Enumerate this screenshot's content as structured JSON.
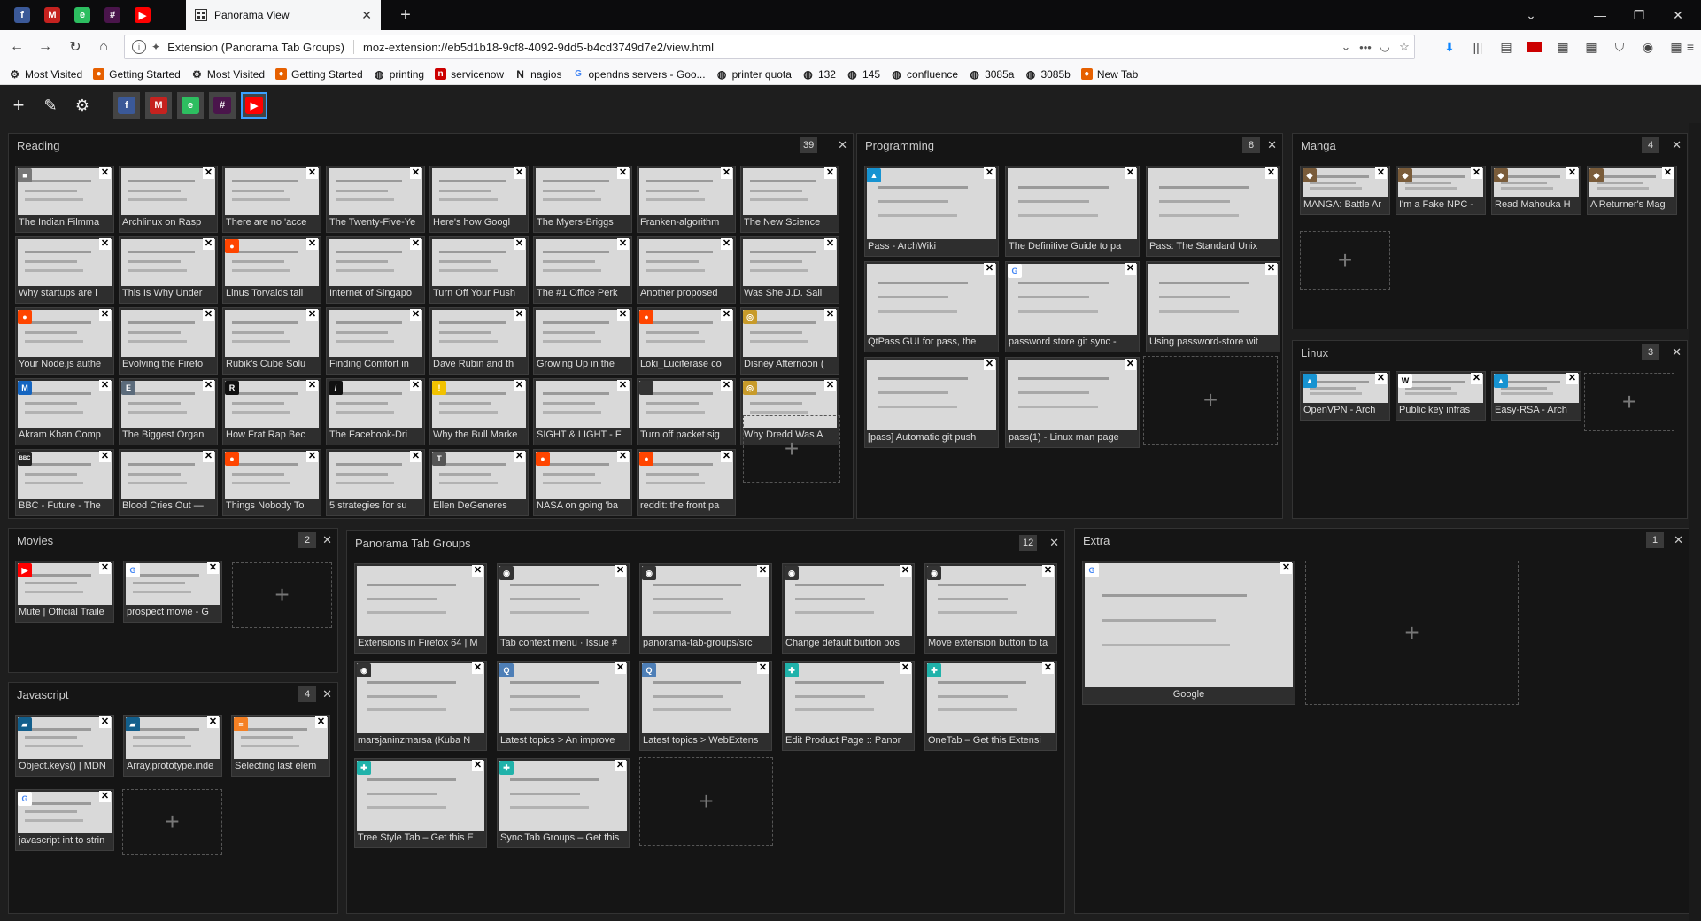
{
  "browser": {
    "pinned_tabs": [
      {
        "icon": "facebook-icon",
        "glyph": "f",
        "color": "#3b5998"
      },
      {
        "icon": "gmail-icon",
        "glyph": "M",
        "color": "#c5221f"
      },
      {
        "icon": "evernote-icon",
        "glyph": "e",
        "color": "#2dbe60"
      },
      {
        "icon": "slack-icon",
        "glyph": "#",
        "color": "#4a154b"
      },
      {
        "icon": "youtube-icon",
        "glyph": "▶",
        "color": "#ff0000"
      }
    ],
    "active_tab_title": "Panorama View",
    "url_identity": "Extension (Panorama Tab Groups)",
    "url": "moz-extension://eb5d1b18-9cf8-4092-9dd5-b4cd3749d7e2/view.html"
  },
  "bookmarks": [
    {
      "label": "Most Visited",
      "icon": "gear-icon"
    },
    {
      "label": "Getting Started",
      "icon": "firefox-icon"
    },
    {
      "label": "Most Visited",
      "icon": "gear-icon"
    },
    {
      "label": "Getting Started",
      "icon": "firefox-icon"
    },
    {
      "label": "printing",
      "icon": "globe-icon"
    },
    {
      "label": "servicenow",
      "icon": "servicenow-icon"
    },
    {
      "label": "nagios",
      "icon": "nagios-icon"
    },
    {
      "label": "opendns servers - Goo...",
      "icon": "google-icon"
    },
    {
      "label": "printer quota",
      "icon": "globe-icon"
    },
    {
      "label": "132",
      "icon": "globe-icon"
    },
    {
      "label": "145",
      "icon": "globe-icon"
    },
    {
      "label": "confluence",
      "icon": "globe-icon"
    },
    {
      "label": "3085a",
      "icon": "globe-icon"
    },
    {
      "label": "3085b",
      "icon": "globe-icon"
    },
    {
      "label": "New Tab",
      "icon": "firefox-icon"
    }
  ],
  "new_tab_glyph": "+",
  "groups": [
    {
      "name": "Reading",
      "count": "39",
      "tabs": [
        {
          "title": "The Indian Filmma",
          "icon": "doc-icon"
        },
        {
          "title": "Archlinux on Rasp",
          "icon": ""
        },
        {
          "title": "There are no 'acce",
          "icon": ""
        },
        {
          "title": "The Twenty-Five-Ye",
          "icon": ""
        },
        {
          "title": "Here's how Googl",
          "icon": ""
        },
        {
          "title": "The Myers-Briggs",
          "icon": ""
        },
        {
          "title": "Franken-algorithm",
          "icon": ""
        },
        {
          "title": "The New Science",
          "icon": ""
        },
        {
          "title": "Why startups are l",
          "icon": ""
        },
        {
          "title": "This Is Why Under",
          "icon": ""
        },
        {
          "title": "Linus Torvalds tall",
          "icon": "reddit-icon"
        },
        {
          "title": "Internet of Singapo",
          "icon": ""
        },
        {
          "title": "Turn Off Your Push",
          "icon": ""
        },
        {
          "title": "The #1 Office Perk",
          "icon": ""
        },
        {
          "title": "Another proposed",
          "icon": ""
        },
        {
          "title": "Was She J.D. Sali",
          "icon": ""
        },
        {
          "title": "Your Node.js authe",
          "icon": "reddit-icon"
        },
        {
          "title": "Evolving the Firefo",
          "icon": ""
        },
        {
          "title": "Rubik's Cube Solu",
          "icon": ""
        },
        {
          "title": "Finding Comfort in",
          "icon": ""
        },
        {
          "title": "Dave Rubin and th",
          "icon": ""
        },
        {
          "title": "Growing Up in the",
          "icon": ""
        },
        {
          "title": "Loki_Luciferase co",
          "icon": "reddit-icon"
        },
        {
          "title": "Disney Afternoon (",
          "icon": "site-icon"
        },
        {
          "title": "Akram Khan Comp",
          "icon": "medium-icon"
        },
        {
          "title": "The Biggest Organ",
          "icon": "e-icon"
        },
        {
          "title": "How Frat Rap Bec",
          "icon": "r-icon"
        },
        {
          "title": "The Facebook-Dri",
          "icon": "a-icon"
        },
        {
          "title": "Why the Bull Marke",
          "icon": "warning-icon"
        },
        {
          "title": "SIGHT & LIGHT - F",
          "icon": ""
        },
        {
          "title": "Turn off packet sig",
          "icon": "apple-icon"
        },
        {
          "title": "Why Dredd Was A",
          "icon": "site-icon"
        },
        {
          "title": "BBC - Future - The",
          "icon": "bbc-icon"
        },
        {
          "title": "Blood Cries Out —",
          "icon": ""
        },
        {
          "title": "Things Nobody To",
          "icon": "reddit-icon"
        },
        {
          "title": "5 strategies for su",
          "icon": ""
        },
        {
          "title": "Ellen DeGeneres",
          "icon": "t-icon"
        },
        {
          "title": "NASA on going 'ba",
          "icon": "reddit-icon"
        },
        {
          "title": "reddit: the front pa",
          "icon": "reddit-icon"
        }
      ]
    },
    {
      "name": "Programming",
      "count": "8",
      "tabs": [
        {
          "title": "Pass - ArchWiki",
          "icon": "arch-icon"
        },
        {
          "title": "The Definitive Guide to pa",
          "icon": ""
        },
        {
          "title": "Pass: The Standard Unix",
          "icon": ""
        },
        {
          "title": "QtPass GUI for pass, the",
          "icon": ""
        },
        {
          "title": "password store git sync -",
          "icon": "google-icon"
        },
        {
          "title": "Using password-store wit",
          "icon": ""
        },
        {
          "title": "[pass] Automatic git push",
          "icon": ""
        },
        {
          "title": "pass(1) - Linux man page",
          "icon": ""
        }
      ]
    },
    {
      "name": "Manga",
      "count": "4",
      "tabs": [
        {
          "title": "MANGA: Battle Ar",
          "icon": "manga-icon"
        },
        {
          "title": "I'm a Fake NPC -",
          "icon": "manga-icon"
        },
        {
          "title": "Read Mahouka H",
          "icon": "manga-icon"
        },
        {
          "title": "A Returner's Mag",
          "icon": "manga-icon"
        }
      ]
    },
    {
      "name": "Linux",
      "count": "3",
      "tabs": [
        {
          "title": "OpenVPN - Arch",
          "icon": "arch-icon"
        },
        {
          "title": "Public key infras",
          "icon": "wikipedia-icon"
        },
        {
          "title": "Easy-RSA - Arch",
          "icon": "arch-icon"
        }
      ]
    },
    {
      "name": "Movies",
      "count": "2",
      "tabs": [
        {
          "title": "Mute | Official Traile",
          "icon": "youtube-icon"
        },
        {
          "title": "prospect movie - G",
          "icon": "google-icon"
        }
      ]
    },
    {
      "name": "Javascript",
      "count": "4",
      "tabs": [
        {
          "title": "Object.keys() | MDN",
          "icon": "mdn-icon"
        },
        {
          "title": "Array.prototype.inde",
          "icon": "mdn-icon"
        },
        {
          "title": "Selecting last elem",
          "icon": "stackoverflow-icon"
        },
        {
          "title": "javascript int to strin",
          "icon": "google-icon"
        }
      ]
    },
    {
      "name": "Panorama Tab Groups",
      "count": "12",
      "tabs": [
        {
          "title": "Extensions in Firefox 64 | M",
          "icon": ""
        },
        {
          "title": "Tab context menu · Issue #",
          "icon": "github-icon"
        },
        {
          "title": "panorama-tab-groups/src",
          "icon": "github-icon"
        },
        {
          "title": "Change default button pos",
          "icon": "github-icon"
        },
        {
          "title": "Move extension button to ta",
          "icon": "github-icon"
        },
        {
          "title": "marsjaninzmarsa (Kuba N",
          "icon": "github-icon"
        },
        {
          "title": "Latest topics > An improve",
          "icon": "discourse-icon"
        },
        {
          "title": "Latest topics > WebExtens",
          "icon": "discourse-icon"
        },
        {
          "title": "Edit Product Page :: Panor",
          "icon": "addons-icon"
        },
        {
          "title": "OneTab – Get this Extensi",
          "icon": "addons-icon"
        },
        {
          "title": "Tree Style Tab – Get this E",
          "icon": "addons-icon"
        },
        {
          "title": "Sync Tab Groups – Get this",
          "icon": "addons-icon"
        }
      ]
    },
    {
      "name": "Extra",
      "count": "1",
      "tabs": [
        {
          "title": "Google",
          "icon": "google-icon"
        }
      ]
    }
  ]
}
